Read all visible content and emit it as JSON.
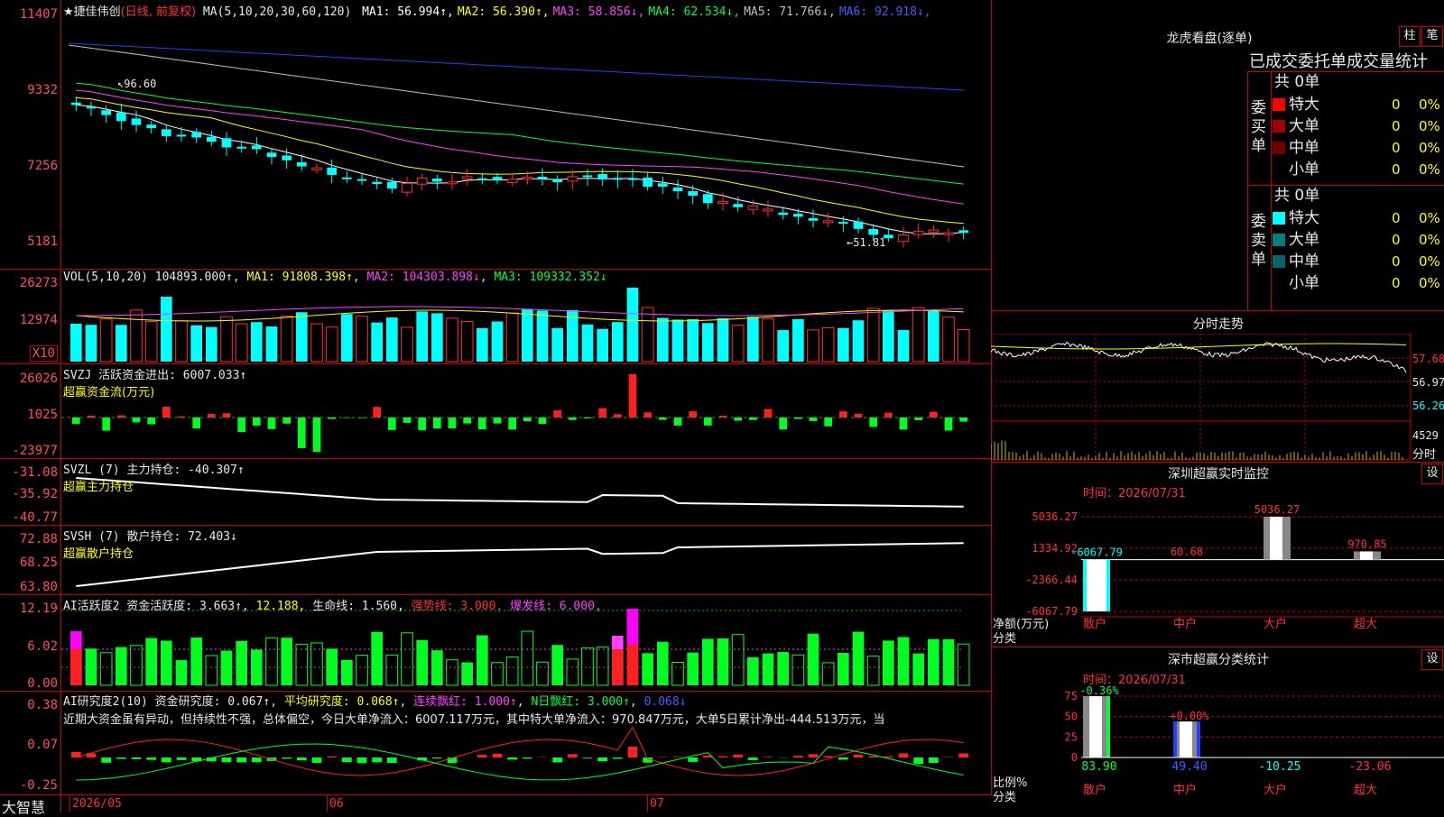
{
  "stock": {
    "name": "★捷佳伟创",
    "mode": "(日线, 前复权)",
    "ma_label": "MA(5,10,20,30,60,120)"
  },
  "ma": [
    {
      "label": "MA1:",
      "value": "56.994↑",
      "color": "#ffffff"
    },
    {
      "label": "MA2:",
      "value": "56.390↑",
      "color": "#ffff00"
    },
    {
      "label": "MA3:",
      "value": "58.856↓",
      "color": "#ff40ff"
    },
    {
      "label": "MA4:",
      "value": "62.534↓",
      "color": "#00ff40"
    },
    {
      "label": "MA5:",
      "value": "71.766↓",
      "color": "#c0c0c0"
    },
    {
      "label": "MA6:",
      "value": "92.918↓",
      "color": "#4060ff"
    }
  ],
  "price_axis": [
    "11407",
    "9332",
    "7256",
    "5181"
  ],
  "price_annot_high": "96.60",
  "price_annot_low": "←51.81",
  "vol": {
    "title": "VOL(5,10,20)",
    "value": "104893.000↑",
    "ma1": "MA1: 91808.398↑",
    "ma2": "MA2: 104303.898↓",
    "ma3": "MA3: 109332.352↓",
    "axis": [
      "26273",
      "12974"
    ],
    "unit": "X10"
  },
  "svzj": {
    "title": "SVZJ  活跃资金进出: 6007.033↑",
    "subtitle": "超赢资金流(万元)",
    "axis": [
      "26026",
      "1025",
      "-23977"
    ]
  },
  "svzl": {
    "title": "SVZL (7) 主力持仓: -40.307↑",
    "subtitle": "超赢主力持仓",
    "axis": [
      "-31.08",
      "-35.92",
      "-40.77"
    ]
  },
  "svsh": {
    "title": "SVSH (7) 散户持仓: 72.403↓",
    "subtitle": "超赢散户持仓",
    "axis": [
      "72.88",
      "68.25",
      "63.80"
    ]
  },
  "ai1": {
    "p1": "AI活跃度2 资金活跃度: 3.663↑",
    "p2": "12.188,",
    "p3": "生命线: 1.560,",
    "p4": "强势线: 3.000,",
    "p5": "爆发线: 6.000,",
    "axis": [
      "12.19",
      "6.02",
      "0.00"
    ]
  },
  "ai2": {
    "p1": "AI研究度2(10) 资金研究度: 0.067↑",
    "p2": "平均研究度: 0.068↑",
    "p3": "连续飘红: 1.000↑",
    "p4": "N日飘红: 3.000↑",
    "p5": "0.068↓",
    "note": "近期大资金虽有异动，但持续性不强，总体偏空，今日大单净流入：6007.117万元，其中特大单净流入：970.847万元，大单5日累计净出-444.513万元，当",
    "axis": [
      "0.38",
      "0.07",
      "-0.25"
    ]
  },
  "xaxis": {
    "logo": "大智慧",
    "labels": [
      "2026/05",
      "06",
      "07"
    ]
  },
  "lhb": {
    "title": "龙虎看盘(逐单)",
    "btn1": "柱",
    "btn2": "笔",
    "header": "已成交委托单成交量统计",
    "buy": {
      "label": "委买单",
      "total": "共 0单",
      "rows": [
        {
          "name": "特大",
          "val": "0",
          "pct": "0%",
          "color": "#ff0000"
        },
        {
          "name": "大单",
          "val": "0",
          "pct": "0%",
          "color": "#a00000"
        },
        {
          "name": "中单",
          "val": "0",
          "pct": "0%",
          "color": "#700000"
        },
        {
          "name": "小单",
          "val": "0",
          "pct": "0%",
          "color": "#000000"
        }
      ]
    },
    "sell": {
      "label": "委卖单",
      "total": "共 0单",
      "rows": [
        {
          "name": "特大",
          "val": "0",
          "pct": "0%",
          "color": "#00ffff"
        },
        {
          "name": "大单",
          "val": "0",
          "pct": "0%",
          "color": "#008080"
        },
        {
          "name": "中单",
          "val": "0",
          "pct": "0%",
          "color": "#006868"
        },
        {
          "name": "小单",
          "val": "0",
          "pct": "0%",
          "color": "#000000"
        }
      ]
    }
  },
  "fenshi": {
    "title": "分时走势",
    "axis": [
      "57.68",
      "56.97",
      "56.26"
    ],
    "vol_label": "4529",
    "unit": "分时"
  },
  "monitor": {
    "title": "深圳超赢实时监控",
    "btn": "设",
    "time": "时间：2026/07/31",
    "axis": [
      "5036.27",
      "1334.92",
      "-2366.44",
      "-6067.79"
    ],
    "ylabel": "净额(万元)",
    "xlabel": "分类",
    "bars": [
      {
        "name": "散户",
        "value": -6067.79,
        "label": "-6067.79"
      },
      {
        "name": "中户",
        "value": 60.68,
        "label": "60.68"
      },
      {
        "name": "大户",
        "value": 5036.27,
        "label": "5036.27"
      },
      {
        "name": "超大",
        "value": 970.85,
        "label": "970.85"
      }
    ]
  },
  "classify": {
    "title": "深市超赢分类统计",
    "btn": "设",
    "time": "时间：2026/07/31",
    "axis": [
      "75",
      "50",
      "25",
      "0"
    ],
    "ylabel": "比例%",
    "xlabel": "分类",
    "cats": [
      "散户",
      "中户",
      "大户",
      "超大"
    ],
    "top": [
      "-0.36%",
      "+0.00%",
      "",
      ""
    ],
    "bottom": [
      "83.90",
      "49.40",
      "-10.25",
      "-23.06"
    ]
  }
}
